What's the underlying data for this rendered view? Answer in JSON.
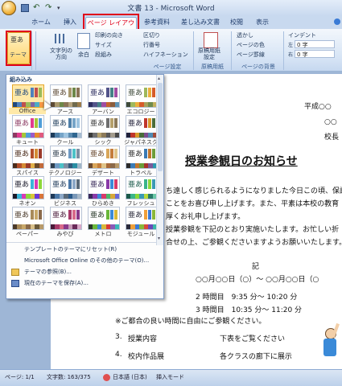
{
  "window": {
    "title": "文書 13 - Microsoft Word"
  },
  "tabs": [
    "ホーム",
    "挿入",
    "ページ レイアウト",
    "参考資料",
    "差し込み文書",
    "校閲",
    "表示"
  ],
  "ribbon": {
    "theme_button_top": "亜あ",
    "theme_button_label": "テーマ",
    "text_direction": "文字列の\n方向",
    "margins": "余白",
    "print_orientation": "印刷の向き",
    "size": "サイズ",
    "columns": "段組み",
    "breaks": "区切り",
    "line_numbers": "行番号",
    "hyphenation": "ハイフネーション",
    "page_setup_group": "ページ設定",
    "manuscript": "原稿用紙\n設定",
    "manuscript_group": "原稿用紙",
    "watermark": "透かし",
    "page_color": "ページの色",
    "page_borders": "ページ罫線",
    "background_group": "ページの背景",
    "indent_label": "インデント",
    "indent_left": "0 字",
    "indent_right": "0 字",
    "indent_left_icon": "左",
    "indent_right_icon": "右"
  },
  "theme_panel": {
    "title": "組み込み",
    "thumb_text": "亜あ",
    "themes": [
      {
        "name": "Office",
        "colors": [
          "#1f497d",
          "#4f81bd",
          "#c0504d",
          "#9bbb59",
          "#8064a2",
          "#4bacc6",
          "#f79646"
        ]
      },
      {
        "name": "アース",
        "colors": [
          "#5d4a35",
          "#a8986e",
          "#6d8748",
          "#8a7456",
          "#b4a27d",
          "#6f6a4d",
          "#9c7c4a"
        ]
      },
      {
        "name": "アーバン",
        "colors": [
          "#2c2d5f",
          "#53548a",
          "#438086",
          "#a04da3",
          "#c4652d",
          "#8b5d3d",
          "#5c92b5"
        ]
      },
      {
        "name": "エコロジー",
        "colors": [
          "#3e4a3a",
          "#9fb85c",
          "#ebaf3c",
          "#d65c2a",
          "#a7a15b",
          "#6f8b4d",
          "#c5b15d"
        ]
      },
      {
        "name": "キュート",
        "colors": [
          "#8b3a62",
          "#e23b8f",
          "#a5c538",
          "#4f9ed9",
          "#9a5bc9",
          "#e68a2e",
          "#e05a7d"
        ]
      },
      {
        "name": "クール",
        "colors": [
          "#1d3b5a",
          "#4e7fa8",
          "#75a4c8",
          "#9ec4e0",
          "#5b8bb0",
          "#2f6690",
          "#a6bcd1"
        ]
      },
      {
        "name": "シック",
        "colors": [
          "#3a3a3a",
          "#6f6f6f",
          "#b5a06b",
          "#8c7a5a",
          "#58585a",
          "#a39c8e",
          "#4a4a4a"
        ]
      },
      {
        "name": "ジャパネスク",
        "colors": [
          "#22213a",
          "#c0362c",
          "#d99a2b",
          "#4a6d3a",
          "#7d4d8f",
          "#4e8ab3",
          "#a34b3a"
        ]
      },
      {
        "name": "スパイス",
        "colors": [
          "#4a2b1a",
          "#b24d2a",
          "#d48b34",
          "#9b3a2a",
          "#e0b04a",
          "#6b4a2a",
          "#c26a3a"
        ]
      },
      {
        "name": "テクノロジー",
        "colors": [
          "#2f3e4e",
          "#6e9ac4",
          "#4bc1c8",
          "#7d8fa3",
          "#325a7c",
          "#2a8fa4",
          "#9fb6c8"
        ]
      },
      {
        "name": "デザート",
        "colors": [
          "#6b4a2f",
          "#d9a65a",
          "#c47c3a",
          "#e0c48a",
          "#a86a3a",
          "#8b6a4a",
          "#b89a6a"
        ]
      },
      {
        "name": "トラベル",
        "colors": [
          "#2a2a2a",
          "#3a7bb5",
          "#c2762c",
          "#6d9d3a",
          "#a8342c",
          "#7a5a9a",
          "#2a9ab0"
        ]
      },
      {
        "name": "ネオン",
        "colors": [
          "#1a1a2a",
          "#3ab5d8",
          "#d83ab5",
          "#8dd83a",
          "#d8c53a",
          "#6a3ad8",
          "#d8743a"
        ]
      },
      {
        "name": "ビジネス",
        "colors": [
          "#1f3a5a",
          "#4a78a8",
          "#8ca8c8",
          "#5a6a7a",
          "#2a5a8a",
          "#7a98b8",
          "#a8b8c8"
        ]
      },
      {
        "name": "ひらめき",
        "colors": [
          "#3a2a5a",
          "#8a3aa8",
          "#3a8ad8",
          "#d83a6a",
          "#4ab86a",
          "#d8a83a",
          "#6a6ad8"
        ]
      },
      {
        "name": "フレッシュ",
        "colors": [
          "#1a5a4a",
          "#3ab58a",
          "#8ad83a",
          "#3a9ab5",
          "#b5d83a",
          "#2a7a6a",
          "#6ac8a8"
        ]
      },
      {
        "name": "ペーパー",
        "colors": [
          "#4a3a2a",
          "#a88a5a",
          "#c8a86a",
          "#8a6a4a",
          "#d8c08a",
          "#6a5a3a",
          "#b89a6a"
        ]
      },
      {
        "name": "みやび",
        "colors": [
          "#4a1a3a",
          "#a83a6a",
          "#d86a8a",
          "#8a3a8a",
          "#c89ab8",
          "#6a2a5a",
          "#d8a8c8"
        ]
      },
      {
        "name": "メトロ",
        "colors": [
          "#2a3a2a",
          "#6ab83a",
          "#3a8ad8",
          "#d8b83a",
          "#d83a3a",
          "#8a5ab8",
          "#3ab8b8"
        ]
      },
      {
        "name": "モジュール",
        "colors": [
          "#2a2a3a",
          "#f0a03a",
          "#3a7ad8",
          "#8ab83a",
          "#d84a3a",
          "#6a4ab8",
          "#3ab8a8"
        ]
      }
    ],
    "menu": [
      "テンプレートのテーマにリセット(R)",
      "Microsoft Office Online のその他のテーマ(O)...",
      "テーマの参照(B)...",
      "現在のテーマを保存(A)..."
    ]
  },
  "document": {
    "date": "平成○○",
    "org": "○○",
    "principal": "校長",
    "heading": "授業参観日のお知らせ",
    "para1": "ち遠しく感じられるようになりました今日この頃、保護",
    "para2": "ことをお喜び申し上げます。また、平素は本校の教育",
    "para3": "厚くお礼申し上げます。",
    "para4": "授業参観を下記のとおり実施いたします。お忙しい折",
    "para5": "合せの上、ご参観くださいますようお願いいたします。",
    "ki": "記",
    "date_line": "○○月○○日（○）～ ○○月○○日（○",
    "period2": "2 時間目　9:35 分～ 10:20 分",
    "period3": "3 時間目　10:35 分～ 11:20 分",
    "note": "※ご都合の良い時間に自由にご参観ください。",
    "item3_no": "3.",
    "item3": "授業内容",
    "item3_val": "下表をご覧ください",
    "item4_no": "4.",
    "item4": "校内作品展",
    "item4_val": "各クラスの廊下に展示"
  },
  "status": {
    "page": "ページ: 1/1",
    "words": "文字数: 163/375",
    "language": "日本語 (日本)",
    "mode": "挿入モード"
  }
}
